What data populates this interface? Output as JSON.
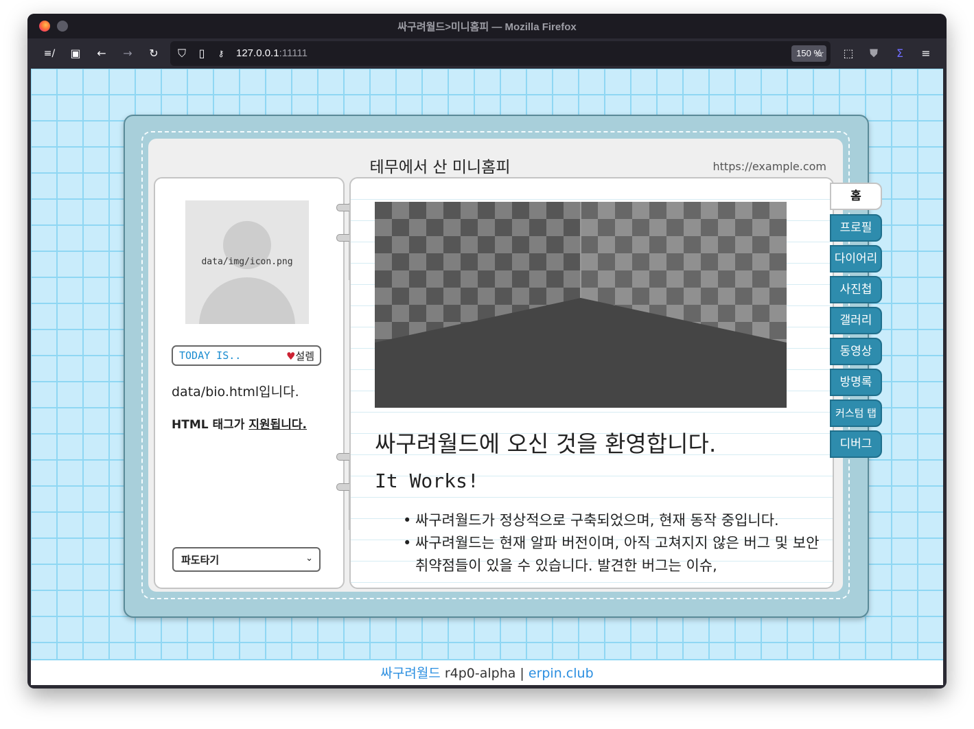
{
  "browser": {
    "window_title": "싸구려월드>미니홈피 — Mozilla Firefox",
    "url_host": "127.0.0.1",
    "url_port": ":11111",
    "zoom": "150 %"
  },
  "minihompy": {
    "title": "테무에서 산 미니홈피",
    "url": "https://example.com",
    "profile": {
      "avatar_path": "data/img/icon.png",
      "today_label": "TODAY IS..",
      "today_mood_icon": "♥",
      "today_mood": "설렘",
      "bio_line1": "data/bio.html입니다.",
      "bio_line2_prefix": "HTML 태그가 ",
      "bio_line2_underlined": "지원됩니다.",
      "wave_select": "파도타기"
    },
    "main": {
      "heading": "싸구려월드에 오신 것을 환영합니다.",
      "subheading": "It Works!",
      "bullets": [
        "싸구려월드가 정상적으로 구축되었으며, 현재 동작 중입니다.",
        "싸구려월드는 현재 알파 버전이며, 아직 고쳐지지 않은 버그 및 보안 취약점들이 있을 수 있습니다. 발견한 버그는 이슈,"
      ]
    },
    "tabs": [
      "홈",
      "프로필",
      "다이어리",
      "사진첩",
      "갤러리",
      "동영상",
      "방명록",
      "커스텀 탭",
      "디버그"
    ]
  },
  "footer": {
    "brand": "싸구려월드",
    "version": " r4p0-alpha | ",
    "site": "erpin.club"
  }
}
